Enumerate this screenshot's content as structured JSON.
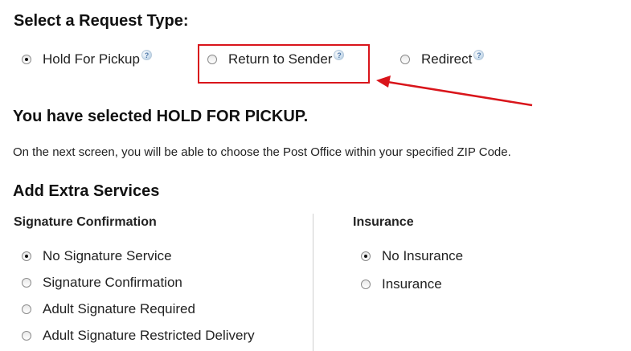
{
  "request_section": {
    "title": "Select a Request Type:",
    "options": [
      {
        "label": "Hold For Pickup",
        "checked": true,
        "help": "?"
      },
      {
        "label": "Return to Sender",
        "checked": false,
        "help": "?"
      },
      {
        "label": "Redirect",
        "checked": false,
        "help": "?"
      }
    ]
  },
  "selected": {
    "heading": "You have selected HOLD FOR PICKUP.",
    "info": "On the next screen, you will be able to choose the Post Office within your specified ZIP Code."
  },
  "extra_services": {
    "title": "Add Extra Services",
    "signature": {
      "heading": "Signature Confirmation",
      "options": [
        {
          "label": "No Signature Service",
          "checked": true
        },
        {
          "label": "Signature Confirmation",
          "checked": false
        },
        {
          "label": "Adult Signature Required",
          "checked": false
        },
        {
          "label": "Adult Signature Restricted Delivery",
          "checked": false
        }
      ]
    },
    "insurance": {
      "heading": "Insurance",
      "options": [
        {
          "label": "No Insurance",
          "checked": true
        },
        {
          "label": "Insurance",
          "checked": false
        }
      ]
    }
  },
  "annotation": {
    "color": "#d9151b"
  }
}
